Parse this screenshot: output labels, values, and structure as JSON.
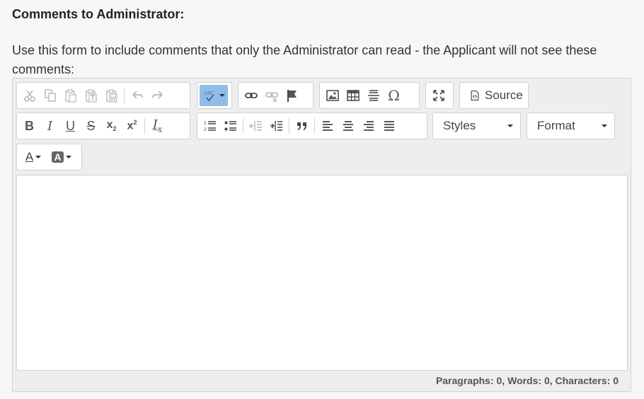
{
  "heading": "Comments to Administrator:",
  "help_text": "Use this form to include comments that only the Administrator can read - the Applicant will not see these comments:",
  "toolbar": {
    "source_label": "Source",
    "styles_label": "Styles",
    "format_label": "Format",
    "bold": "B",
    "italic": "I",
    "underline": "U",
    "strike": "S",
    "subscript": "x",
    "subscript_mark": "2",
    "superscript": "x",
    "superscript_mark": "2",
    "remove_format": "I",
    "remove_format_mark": "x",
    "text_color": "A",
    "bg_color": "A"
  },
  "status_bar": "Paragraphs: 0, Words: 0, Characters: 0",
  "colors": {
    "accent": "#92bce8",
    "toolbar_bg": "#eeeeee",
    "border": "#d1d1d1"
  }
}
